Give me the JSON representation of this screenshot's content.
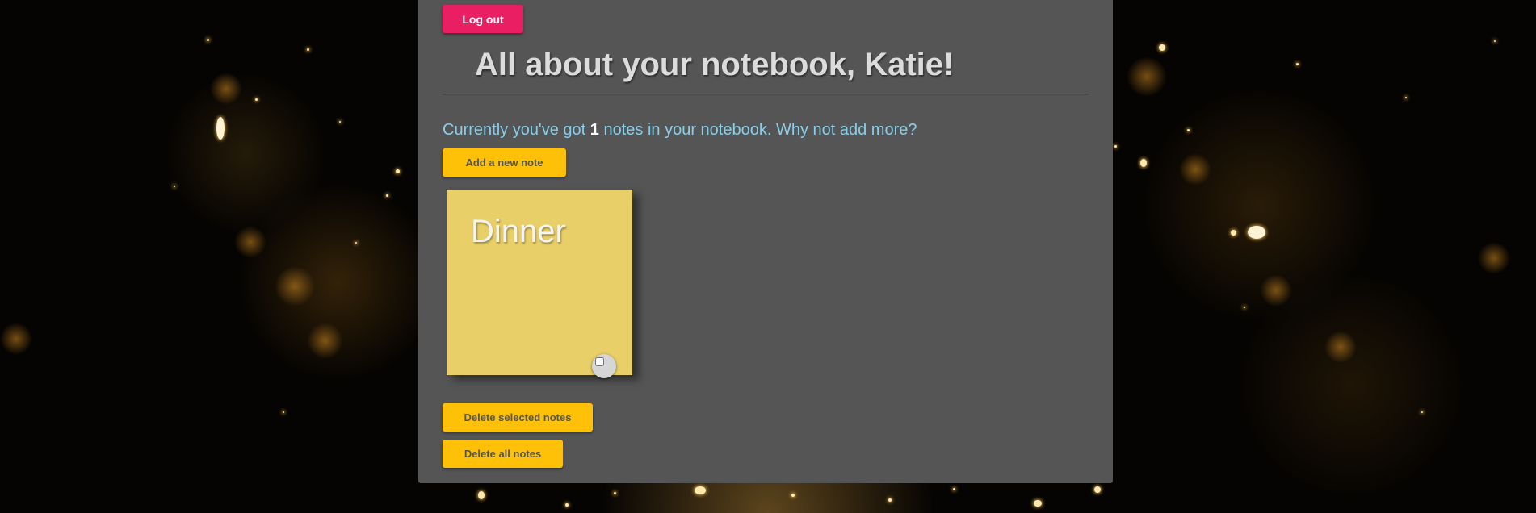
{
  "header": {
    "logout_label": "Log out",
    "title": "All about your notebook, Katie!"
  },
  "summary": {
    "prefix": "Currently you've got ",
    "count": "1",
    "suffix": " notes in your notebook. Why not add more?"
  },
  "actions": {
    "add_label": "Add a new note",
    "delete_selected_label": "Delete selected notes",
    "delete_all_label": "Delete all notes"
  },
  "notes": [
    {
      "title": "Dinner",
      "selected": false
    }
  ],
  "colors": {
    "panel": "#555555",
    "logout_button": "#e91e63",
    "action_button": "#ffc107",
    "sticky_note": "#e8cf68",
    "summary_text": "#87ceeb"
  }
}
